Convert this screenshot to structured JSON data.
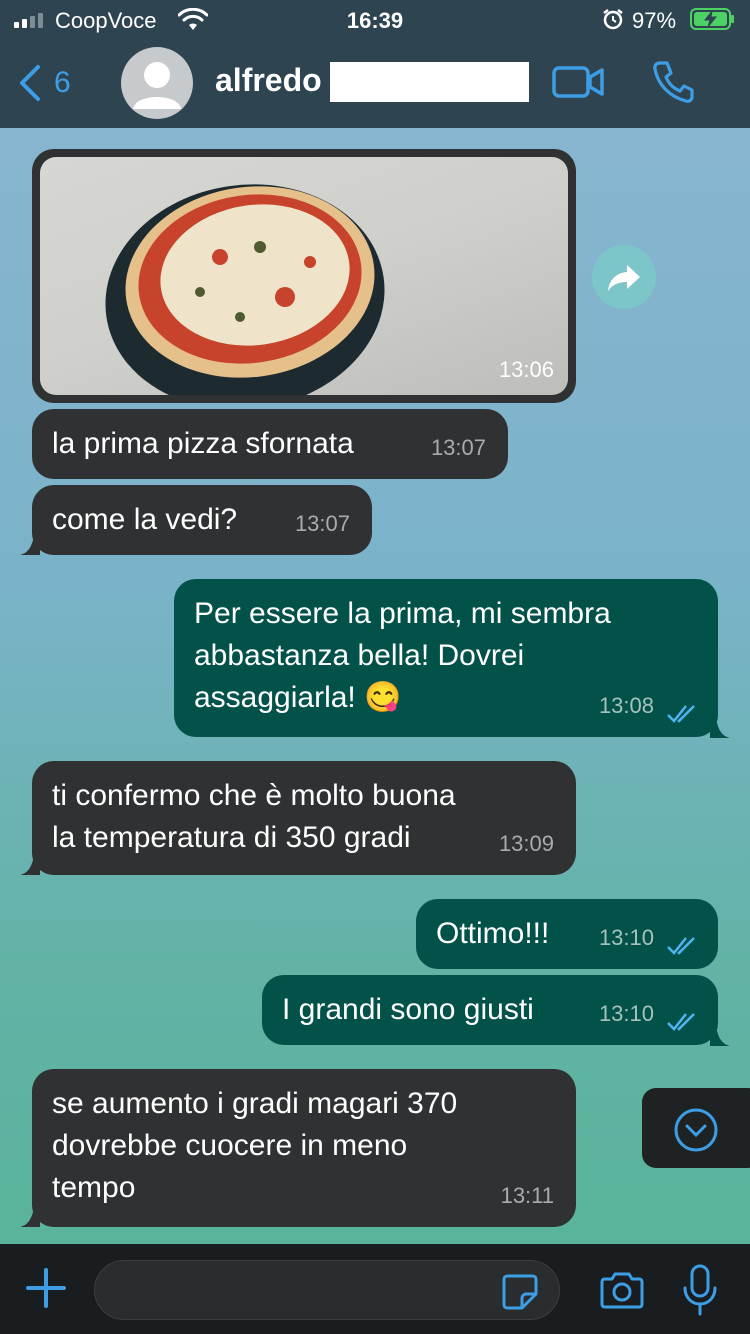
{
  "status_bar": {
    "carrier": "CoopVoce",
    "time": "16:39",
    "battery_pct": "97%"
  },
  "header": {
    "back_count": "6",
    "contact_name": "alfredo",
    "video_icon": "video-camera-icon",
    "call_icon": "phone-icon"
  },
  "photo_message": {
    "time": "13:06"
  },
  "messages": [
    {
      "dir": "in",
      "text": "la prima pizza sfornata",
      "time": "13:07"
    },
    {
      "dir": "in",
      "text": "come la vedi?",
      "time": "13:07"
    },
    {
      "dir": "out",
      "lines": [
        "Per essere la prima, mi sembra",
        "abbastanza bella! Dovrei",
        "assaggiarla! 😋"
      ],
      "time": "13:08"
    },
    {
      "dir": "in",
      "lines": [
        "ti confermo che è molto buona",
        "la temperatura di 350 gradi"
      ],
      "time": "13:09"
    },
    {
      "dir": "out",
      "text": "Ottimo!!!",
      "time": "13:10"
    },
    {
      "dir": "out",
      "text": "I grandi sono giusti",
      "time": "13:10"
    },
    {
      "dir": "in",
      "lines": [
        "se aumento i gradi magari 370",
        "dovrebbe cuocere in meno",
        "tempo"
      ],
      "time": "13:11"
    }
  ],
  "colors": {
    "header_bg": "#2e4551",
    "incoming_bubble": "#2f3133",
    "outgoing_bubble": "#03524a",
    "accent": "#3d9ee6"
  }
}
